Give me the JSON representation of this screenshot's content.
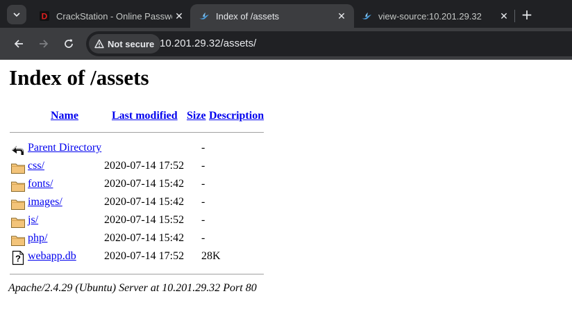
{
  "browser": {
    "tabs": [
      {
        "title": "CrackStation - Online Password Hash Cracking",
        "active": false,
        "favicon": "crackstation-d-icon"
      },
      {
        "title": "Index of /assets",
        "active": true,
        "favicon": "bird-icon"
      },
      {
        "title": "view-source:10.201.29.32",
        "active": false,
        "favicon": "bird-icon"
      }
    ],
    "security_label": "Not secure",
    "url": "10.201.29.32/assets/"
  },
  "page": {
    "heading": "Index of /assets",
    "columns": {
      "name": "Name",
      "last_modified": "Last modified",
      "size": "Size",
      "description": "Description"
    },
    "parent": {
      "name": "Parent Directory",
      "size": "-"
    },
    "rows": [
      {
        "name": "css/",
        "modified": "2020-07-14 17:52",
        "size": "-",
        "icon": "folder-icon"
      },
      {
        "name": "fonts/",
        "modified": "2020-07-14 15:42",
        "size": "-",
        "icon": "folder-icon"
      },
      {
        "name": "images/",
        "modified": "2020-07-14 15:42",
        "size": "-",
        "icon": "folder-icon"
      },
      {
        "name": "js/",
        "modified": "2020-07-14 15:52",
        "size": "-",
        "icon": "folder-icon"
      },
      {
        "name": "php/",
        "modified": "2020-07-14 15:42",
        "size": "-",
        "icon": "folder-icon"
      },
      {
        "name": "webapp.db",
        "modified": "2020-07-14 17:52",
        "size": "28K",
        "icon": "unknown-file-icon"
      }
    ],
    "address": "Apache/2.4.29 (Ubuntu) Server at 10.201.29.32 Port 80"
  }
}
